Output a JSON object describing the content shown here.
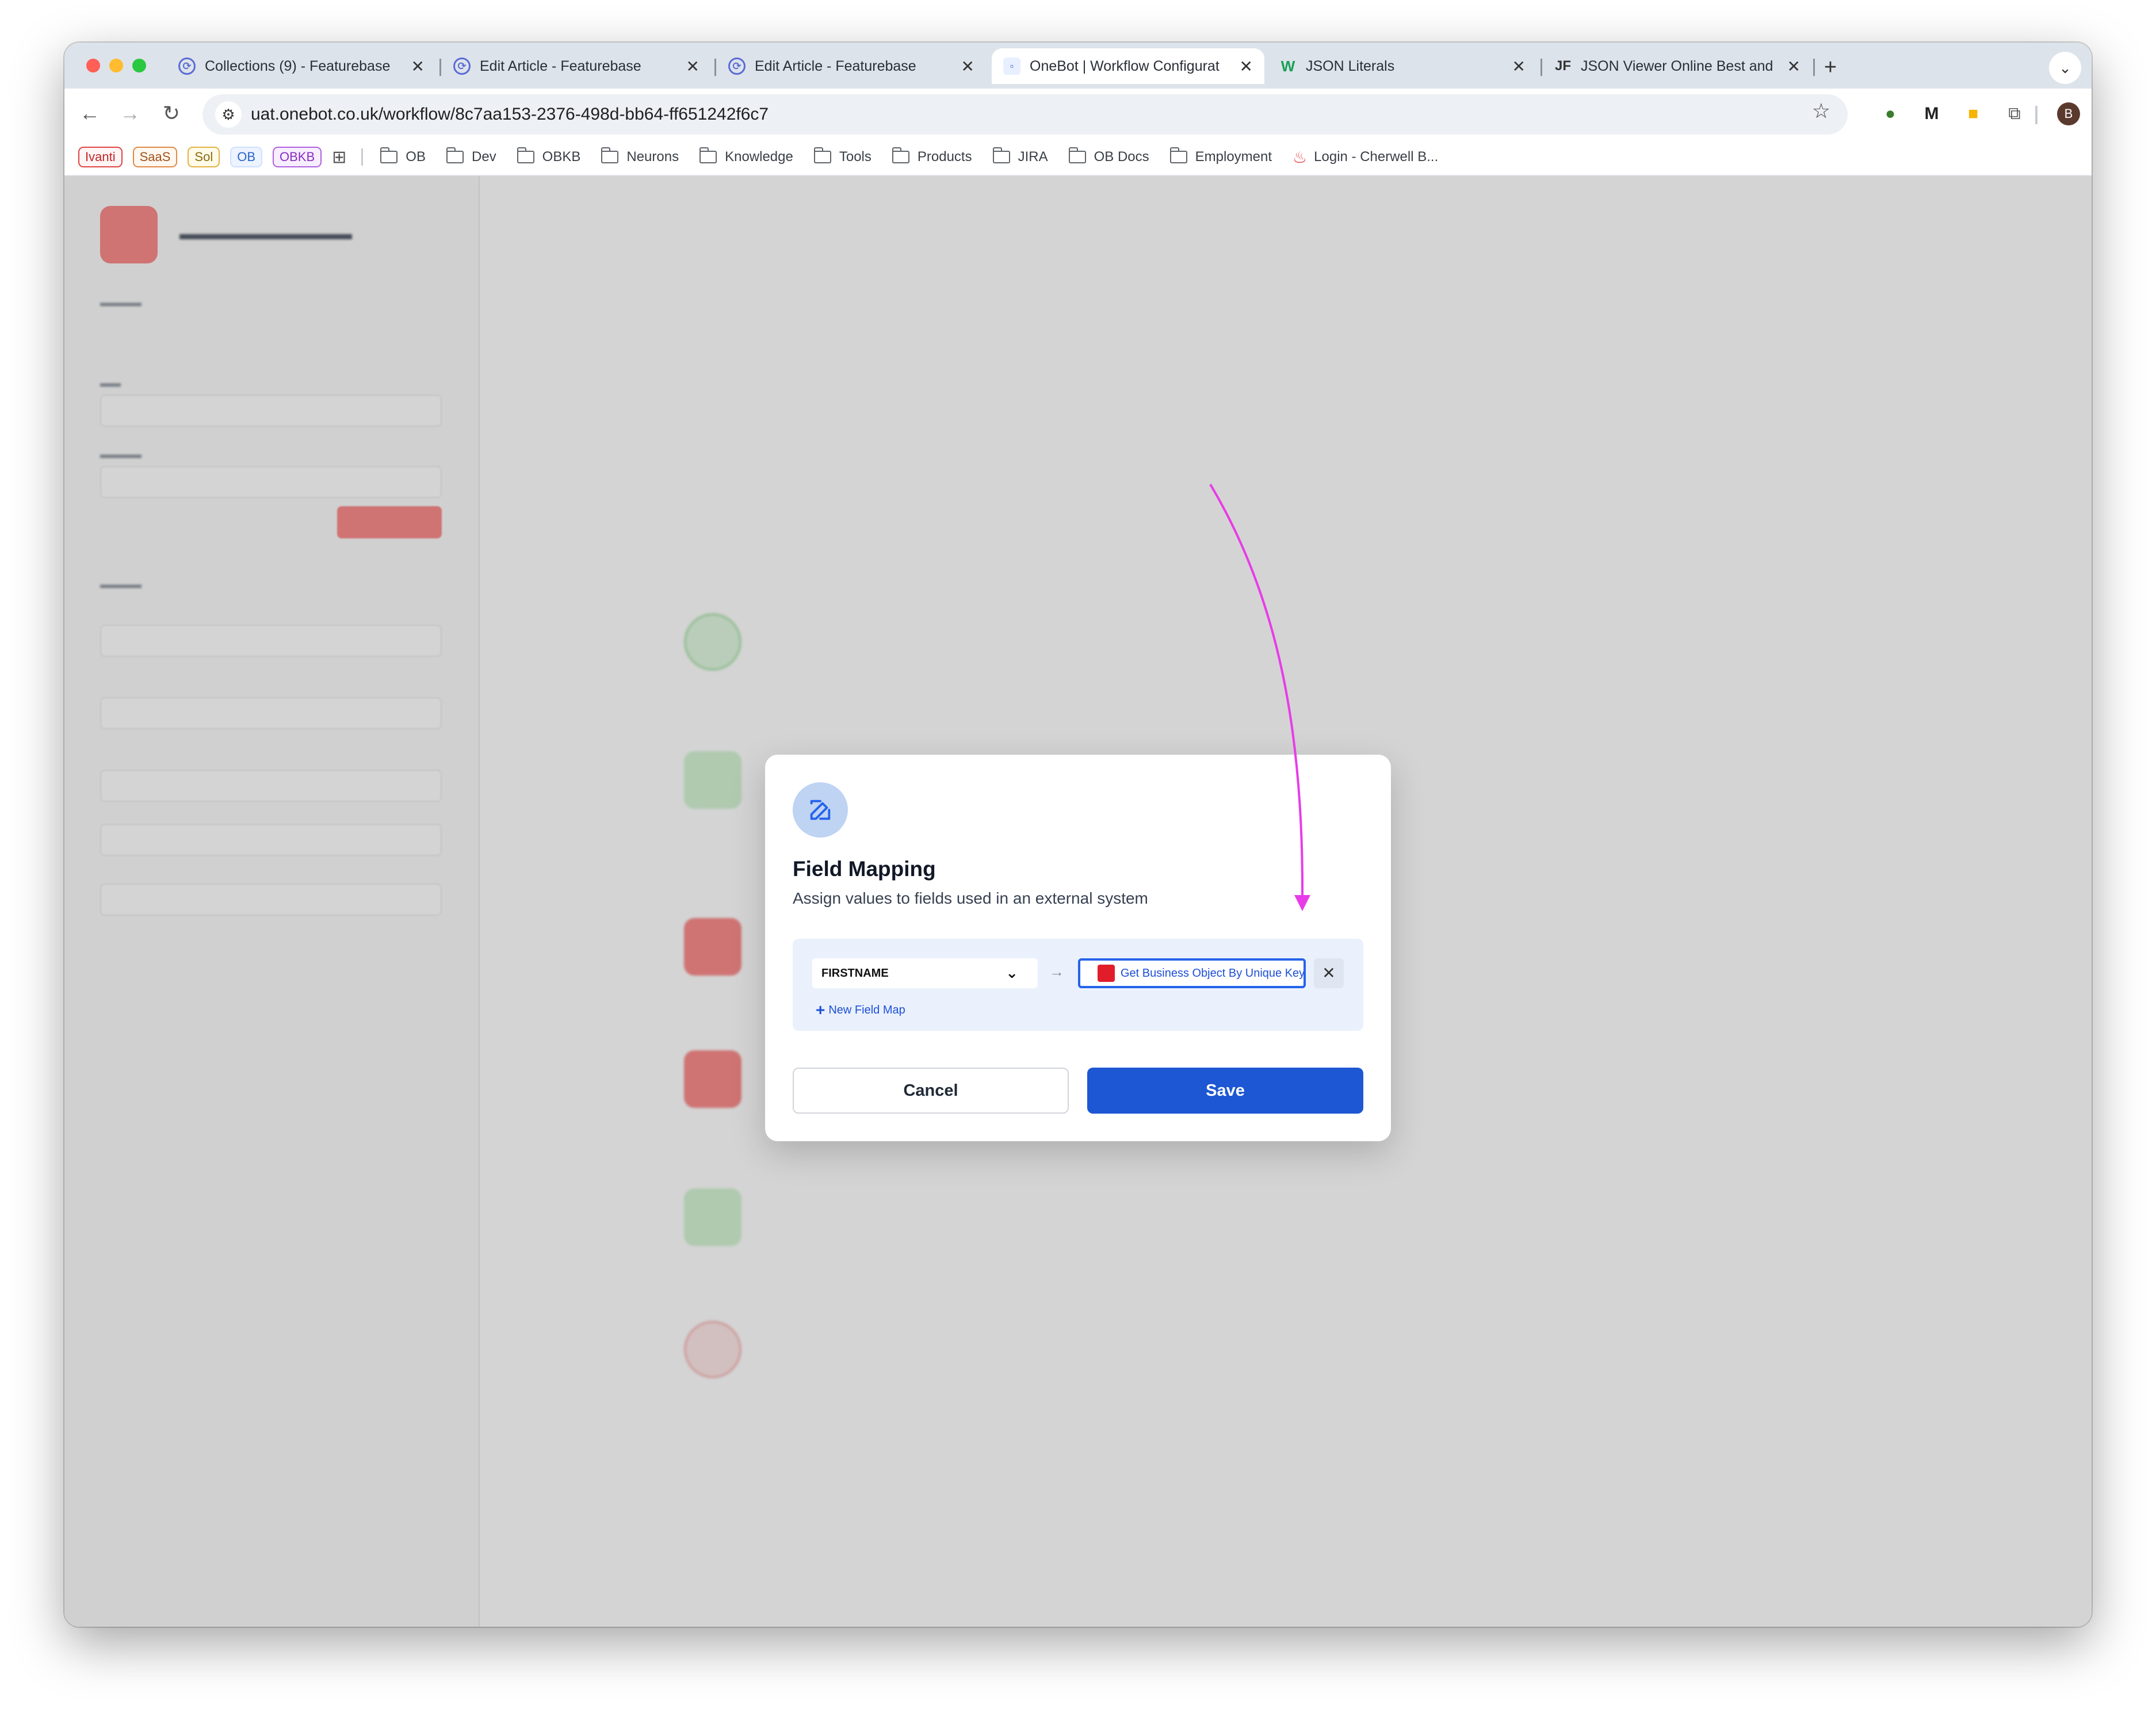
{
  "colors": {
    "accent": "#1d57d3",
    "annotation": "#e83ce8",
    "logo_red": "#e11d2a"
  },
  "tabs": [
    {
      "title": "Collections (9) - Featurebase",
      "icon": "featurebase-icon"
    },
    {
      "title": "Edit Article - Featurebase",
      "icon": "featurebase-icon"
    },
    {
      "title": "Edit Article - Featurebase",
      "icon": "featurebase-icon"
    },
    {
      "title": "OneBot | Workflow Configurat",
      "icon": "onebot-icon",
      "active": true
    },
    {
      "title": "JSON Literals",
      "icon": "w-icon"
    },
    {
      "title": "JSON Viewer Online Best and",
      "icon": "jf-icon"
    }
  ],
  "address": {
    "url": "uat.onebot.co.uk/workflow/8c7aa153-2376-498d-bb64-ff651242f6c7"
  },
  "profile_initial": "B",
  "bookmarks": {
    "chips": [
      "Ivanti",
      "SaaS",
      "Sol",
      "OB",
      "OBKB"
    ],
    "folders": [
      "OB",
      "Dev",
      "OBKB",
      "Neurons",
      "Knowledge",
      "Tools",
      "Products",
      "JIRA",
      "OB Docs",
      "Employment"
    ],
    "login": "Login - Cherwell B..."
  },
  "modal": {
    "title": "Field Mapping",
    "subtitle": "Assign values to fields used in an external system",
    "field": "FIRSTNAME",
    "value": "Get Business Object By Unique Key",
    "new_map": "New Field Map",
    "cancel": "Cancel",
    "save": "Save"
  }
}
